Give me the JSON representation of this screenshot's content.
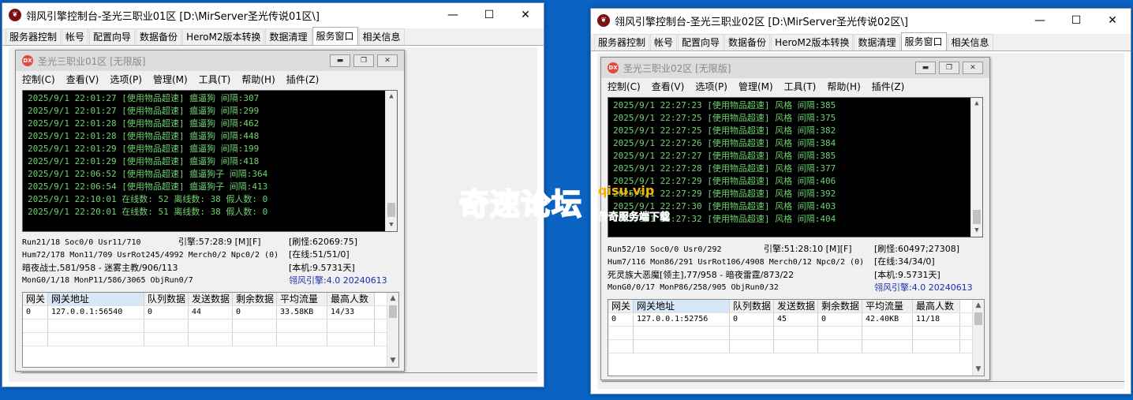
{
  "windows": [
    {
      "title": "翎风引擎控制台-圣光三职业01区 [D:\\MirServer圣光传说01区\\]",
      "controls": {
        "minimize": "—",
        "maximize": "☐",
        "close": "✕"
      },
      "tabs": [
        "服务器控制",
        "帐号",
        "配置向导",
        "数据备份",
        "HeroM2版本转换",
        "数据清理",
        "服务窗口",
        "相关信息"
      ],
      "active_tab": "服务窗口",
      "server": {
        "title": "圣光三职业01区 [无限版]",
        "icon": "dx-icon",
        "menu": [
          "控制(C)",
          "查看(V)",
          "选项(P)",
          "管理(M)",
          "工具(T)",
          "帮助(H)",
          "插件(Z)"
        ],
        "log": [
          "2025/9/1 22:01:27 [使用物品超速] 瘟逼狗 间隔:307",
          "2025/9/1 22:01:27 [使用物品超速] 瘟逼狗 间隔:299",
          "2025/9/1 22:01:28 [使用物品超速] 瘟逼狗 间隔:462",
          "2025/9/1 22:01:28 [使用物品超速] 瘟逼狗 间隔:448",
          "2025/9/1 22:01:29 [使用物品超速] 瘟逼狗 间隔:199",
          "2025/9/1 22:01:29 [使用物品超速] 瘟逼狗 间隔:418",
          "2025/9/1 22:06:52 [使用物品超速] 瘟逼狗子 间隔:364",
          "2025/9/1 22:06:54 [使用物品超速] 瘟逼狗子 间隔:413",
          "2025/9/1 22:10:01 在线数: 52 离线数: 38 假人数: 0",
          "2025/9/1 22:20:01 在线数: 51 离线数: 38 假人数: 0"
        ],
        "status": {
          "run": "Run21/18 Soc0/0 Usr11/710",
          "engine": "引擎:57:28:9 [M][F]",
          "refresh": "[刷怪:62069:75]",
          "hum": "Hum72/178 Mon11/709 UsrRot245/4992 Merch0/2 Npc0/2 (0)",
          "online": "[在线:51/51/0]",
          "boss": "暗夜战士,581/958 - 迷雾主教/906/113",
          "local": "[本机:9.5731天]",
          "mon": "MonG0/1/18 MonP11/586/3065 ObjRun0/7",
          "version": "翎风引擎:4.0 20240613"
        },
        "grid": {
          "headers": [
            "网关",
            "网关地址",
            "队列数据",
            "发送数据",
            "剩余数据",
            "平均流量",
            "最高人数"
          ],
          "rows": [
            [
              "0",
              "127.0.0.1:56540",
              "0",
              "44",
              "0",
              "33.58KB",
              "14/33"
            ]
          ]
        }
      }
    },
    {
      "title": "翎风引擎控制台-圣光三职业02区 [D:\\MirServer圣光传说02区\\]",
      "controls": {
        "minimize": "—",
        "maximize": "☐",
        "close": "✕"
      },
      "tabs": [
        "服务器控制",
        "帐号",
        "配置向导",
        "数据备份",
        "HeroM2版本转换",
        "数据清理",
        "服务窗口",
        "相关信息"
      ],
      "active_tab": "服务窗口",
      "server": {
        "title": "圣光三职业02区 [无限版]",
        "icon": "dx-icon",
        "menu": [
          "控制(C)",
          "查看(V)",
          "选项(P)",
          "管理(M)",
          "工具(T)",
          "帮助(H)",
          "插件(Z)"
        ],
        "log": [
          "2025/9/1 22:27:23 [使用物品超速] 风格 间隔:385",
          "2025/9/1 22:27:25 [使用物品超速] 风格 间隔:375",
          "2025/9/1 22:27:25 [使用物品超速] 风格 间隔:382",
          "2025/9/1 22:27:26 [使用物品超速] 风格 间隔:384",
          "2025/9/1 22:27:27 [使用物品超速] 风格 间隔:385",
          "2025/9/1 22:27:28 [使用物品超速] 风格 间隔:377",
          "2025/9/1 22:27:29 [使用物品超速] 风格 间隔:406",
          "2025/9/1 22:27:29 [使用物品超速] 风格 间隔:392",
          "2025/9/1 22:27:30 [使用物品超速] 风格 间隔:403",
          "2025/9/1 22:27:32 [使用物品超速] 风格 间隔:404"
        ],
        "status": {
          "run": "Run52/10 Soc0/0 Usr0/292",
          "engine": "引擎:51:28:10 [M][F]",
          "refresh": "[刷怪:60497;27308]",
          "hum": "Hum7/116 Mon86/291 UsrRot106/4908 Merch0/12 Npc0/2 (0)",
          "online": "[在线:34/34/0]",
          "boss": "死灵族大恶魔[领主],77/958 - 暗夜雷霆/873/22",
          "local": "[本机:9.5731天]",
          "mon": "MonG0/0/17 MonP86/258/905 ObjRun0/32",
          "version": "翎风引擎:4.0 20240613"
        },
        "grid": {
          "headers": [
            "网关",
            "网关地址",
            "队列数据",
            "发送数据",
            "剩余数据",
            "平均流量",
            "最高人数"
          ],
          "rows": [
            [
              "0",
              "127.0.0.1:52756",
              "0",
              "45",
              "0",
              "42.40KB",
              "11/18"
            ]
          ]
        }
      }
    }
  ],
  "watermark": {
    "main": "奇速论坛",
    "url": "qisu.vip",
    "sub": "传奇服务端下载"
  },
  "colors": {
    "desktop": "#0a63c2",
    "console_bg": "#000000",
    "console_text": "#6fd36f",
    "status_blue": "#1a2fb0"
  }
}
